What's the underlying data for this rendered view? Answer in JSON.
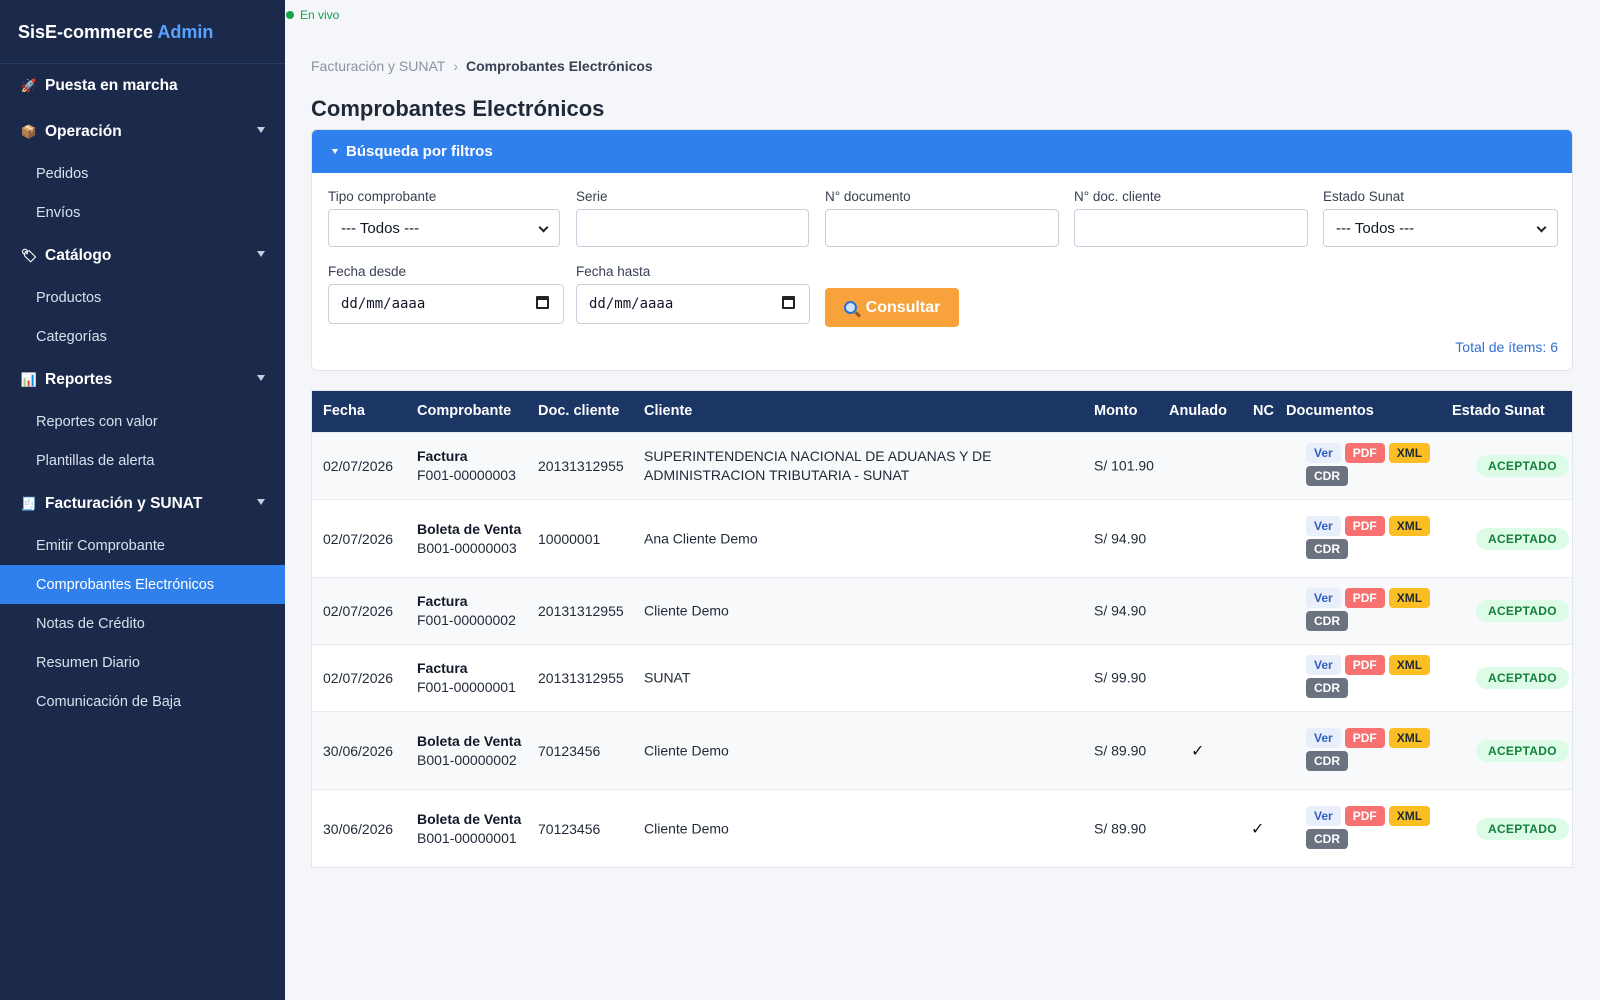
{
  "brand": {
    "name": "SisE-commerce",
    "accent": "Admin"
  },
  "live": {
    "label": "En vivo"
  },
  "sidebar": {
    "sections": [
      {
        "label": "Puesta en marcha",
        "icon": "rocket-icon",
        "glyph": "🚀",
        "items": []
      },
      {
        "label": "Operación",
        "icon": "box-icon",
        "glyph": "📦",
        "items": [
          "Pedidos",
          "Envíos"
        ]
      },
      {
        "label": "Catálogo",
        "icon": "tag-icon",
        "glyph": "🏷",
        "items": [
          "Productos",
          "Categorías"
        ]
      },
      {
        "label": "Reportes",
        "icon": "bar-chart-icon",
        "glyph": "📊",
        "items": [
          "Reportes con valor",
          "Plantillas de alerta"
        ]
      },
      {
        "label": "Facturación y SUNAT",
        "icon": "receipt-icon",
        "glyph": "🧾",
        "items": [
          "Emitir Comprobante",
          "Comprobantes Electrónicos",
          "Notas de Crédito",
          "Resumen Diario",
          "Comunicación de Baja"
        ]
      }
    ],
    "active_item": "Comprobantes Electrónicos"
  },
  "breadcrumb": {
    "parent": "Facturación y SUNAT",
    "separator": "›",
    "current": "Comprobantes Electrónicos"
  },
  "page": {
    "title": "Comprobantes Electrónicos"
  },
  "filters": {
    "header": "Búsqueda por filtros",
    "tipo_label": "Tipo comprobante",
    "tipo_value": "--- Todos ---",
    "serie_label": "Serie",
    "serie_value": "",
    "ndoc_label": "N° documento",
    "ndoc_value": "",
    "ndoc_cliente_label": "N° doc. cliente",
    "ndoc_cliente_value": "",
    "estado_label": "Estado Sunat",
    "estado_value": "--- Todos ---",
    "desde_label": "Fecha desde",
    "desde_value": "dd/mm/aaaa",
    "hasta_label": "Fecha hasta",
    "hasta_value": "dd/mm/aaaa",
    "consult_label": "Consultar",
    "total_label": "Total de ítems: 6"
  },
  "table": {
    "headers": [
      "Fecha",
      "Comprobante",
      "Doc. cliente",
      "Cliente",
      "Monto",
      "Anulado",
      "NC",
      "Documentos",
      "Estado Sunat"
    ],
    "badges": {
      "ver": "Ver",
      "pdf": "PDF",
      "xml": "XML",
      "cdr": "CDR"
    },
    "rows": [
      {
        "fecha": "02/07/2026",
        "tipo": "Factura",
        "numero": "F001-00000003",
        "doc": "20131312955",
        "cliente": "SUPERINTENDENCIA NACIONAL DE ADUANAS Y DE ADMINISTRACION TRIBUTARIA - SUNAT",
        "monto": "S/ 101.90",
        "anulado": "",
        "nc": "",
        "estado": "ACEPTADO"
      },
      {
        "fecha": "02/07/2026",
        "tipo": "Boleta de Venta",
        "numero": "B001-00000003",
        "doc": "10000001",
        "cliente": "Ana Cliente Demo",
        "monto": "S/ 94.90",
        "anulado": "",
        "nc": "",
        "estado": "ACEPTADO"
      },
      {
        "fecha": "02/07/2026",
        "tipo": "Factura",
        "numero": "F001-00000002",
        "doc": "20131312955",
        "cliente": "Cliente Demo",
        "monto": "S/ 94.90",
        "anulado": "",
        "nc": "",
        "estado": "ACEPTADO"
      },
      {
        "fecha": "02/07/2026",
        "tipo": "Factura",
        "numero": "F001-00000001",
        "doc": "20131312955",
        "cliente": "SUNAT",
        "monto": "S/ 99.90",
        "anulado": "",
        "nc": "",
        "estado": "ACEPTADO"
      },
      {
        "fecha": "30/06/2026",
        "tipo": "Boleta de Venta",
        "numero": "B001-00000002",
        "doc": "70123456",
        "cliente": "Cliente Demo",
        "monto": "S/ 89.90",
        "anulado": "✓",
        "nc": "",
        "estado": "ACEPTADO"
      },
      {
        "fecha": "30/06/2026",
        "tipo": "Boleta de Venta",
        "numero": "B001-00000001",
        "doc": "70123456",
        "cliente": "Cliente Demo",
        "monto": "S/ 89.90",
        "anulado": "",
        "nc": "✓",
        "estado": "ACEPTADO"
      }
    ]
  },
  "colors": {
    "sidebar": "#1b2a4a",
    "accent": "#2f80ed",
    "table_header": "#1b3564",
    "consult": "#f7a23b",
    "status_ok": "#15803d"
  }
}
